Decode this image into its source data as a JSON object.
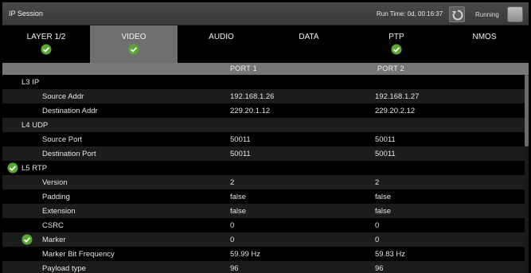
{
  "window": {
    "title": "IP Session"
  },
  "status": {
    "run_time": "Run Time: 0d, 00:16:37",
    "state": "Running"
  },
  "tabs": [
    {
      "label": "LAYER 1/2",
      "status": "ok"
    },
    {
      "label": "VIDEO",
      "status": "ok",
      "selected": true
    },
    {
      "label": "AUDIO"
    },
    {
      "label": "DATA"
    },
    {
      "label": "PTP",
      "status": "ok"
    },
    {
      "label": "NMOS"
    }
  ],
  "columns": {
    "port1": "PORT 1",
    "port2": "PORT 2"
  },
  "rows": [
    {
      "label": "L3 IP",
      "section": true
    },
    {
      "label": "Source Addr",
      "port1": "192.168.1.26",
      "port2": "192.168.1.27"
    },
    {
      "label": "Destination Addr",
      "port1": "229.20.1.12",
      "port2": "229.20.2.12"
    },
    {
      "label": "L4 UDP",
      "section": true
    },
    {
      "label": "Source Port",
      "port1": "50011",
      "port2": "50011"
    },
    {
      "label": "Destination Port",
      "port1": "50011",
      "port2": "50011"
    },
    {
      "label": "L5 RTP",
      "section": true,
      "status": "ok"
    },
    {
      "label": "Version",
      "port1": "2",
      "port2": "2"
    },
    {
      "label": "Padding",
      "port1": "false",
      "port2": "false"
    },
    {
      "label": "Extension",
      "port1": "false",
      "port2": "false"
    },
    {
      "label": "CSRC",
      "port1": "0",
      "port2": "0"
    },
    {
      "label": "Marker",
      "port1": "0",
      "port2": "0",
      "status": "ok"
    },
    {
      "label": "Marker Bit Frequency",
      "port1": "59.99 Hz",
      "port2": "59.83 Hz"
    },
    {
      "label": "Payload type",
      "port1": "96",
      "port2": "96"
    }
  ],
  "icons": {
    "ok": "check-circle-icon",
    "restart": "restart-icon",
    "stop": "stop-icon"
  },
  "colors": {
    "ok_green": "#5aa832",
    "selected_tab": "#6f6f6f",
    "header": "#777777"
  }
}
